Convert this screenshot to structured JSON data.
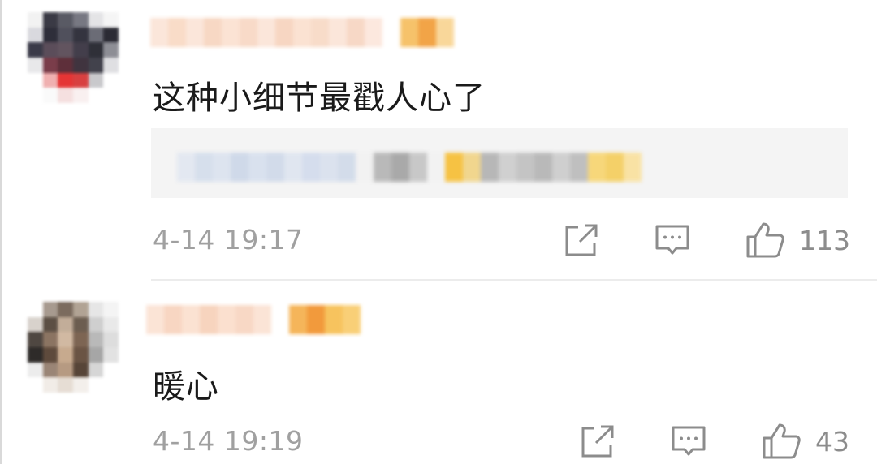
{
  "comments": [
    {
      "text": "这种小细节最戳人心了",
      "timestamp": "4-14 19:17",
      "like_count": "113",
      "has_reply_preview": true
    },
    {
      "text": "暖心",
      "timestamp": "4-14 19:19",
      "like_count": "43",
      "has_reply_preview": false
    }
  ],
  "icons": {
    "share": "share-icon",
    "reply": "comment-icon",
    "like": "thumbs-up-icon"
  },
  "colors": {
    "text_primary": "#1a1a1a",
    "text_secondary": "#a0a0a0",
    "icon_gray": "#8c8c8c",
    "reply_bg": "#f4f4f4",
    "name_orange": "#f6a24a"
  }
}
